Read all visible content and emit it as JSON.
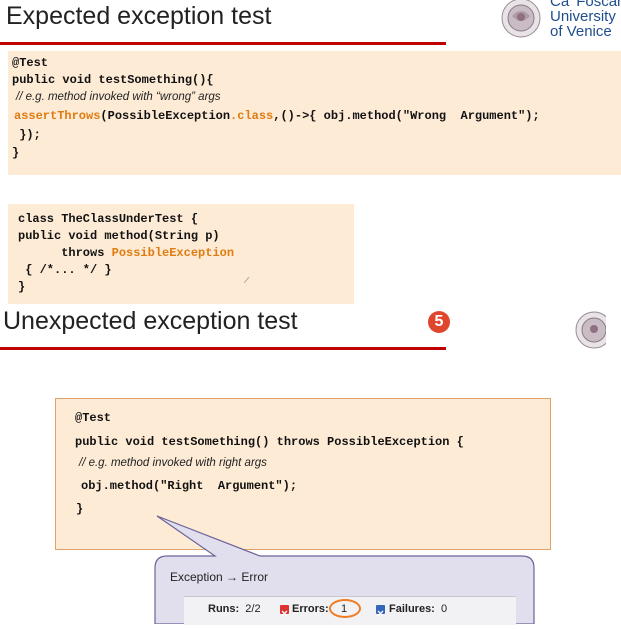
{
  "slide1": {
    "title": "Expected exception test",
    "logo_text": [
      "Ca' Foscari",
      "University",
      "of Venice"
    ],
    "code_main": {
      "line1": "@Test",
      "line2": "public void testSomething(){",
      "comment": "// e.g. method invoked with “wrong” args",
      "line4_fn": "assertThrows",
      "line4_a": "(PossibleException",
      "line4_b": ".class",
      "line4_c": ",()->{ obj.method(\"Wrong  Argument\");",
      "line5": " });",
      "line6": "}"
    },
    "code_class": {
      "line1": "class TheClassUnderTest {",
      "line2": "public void method(String p)",
      "line3_a": "      throws ",
      "line3_b": "PossibleException",
      "line4": " { /*... */ }",
      "line5": "}"
    }
  },
  "slide2": {
    "title": "Unexpected exception test",
    "badge": "5",
    "code": {
      "line1": "@Test",
      "line2": "public void testSomething() throws PossibleException {",
      "comment": "// e.g. method invoked with right args",
      "line4": "obj.method(\"Right  Argument\");",
      "line5": "}"
    },
    "callout": {
      "label": "Exception → Error",
      "runs_label": "Runs:",
      "runs_value": "2/2",
      "errors_label": "Errors:",
      "errors_value": "1",
      "failures_label": "Failures:",
      "failures_value": "0"
    }
  },
  "colors": {
    "accent_red": "#c00000",
    "code_bg": "#fdebd6",
    "keyword_orange": "#e07b10",
    "callout_bg": "#e1dfee",
    "callout_border": "#6d6399"
  }
}
